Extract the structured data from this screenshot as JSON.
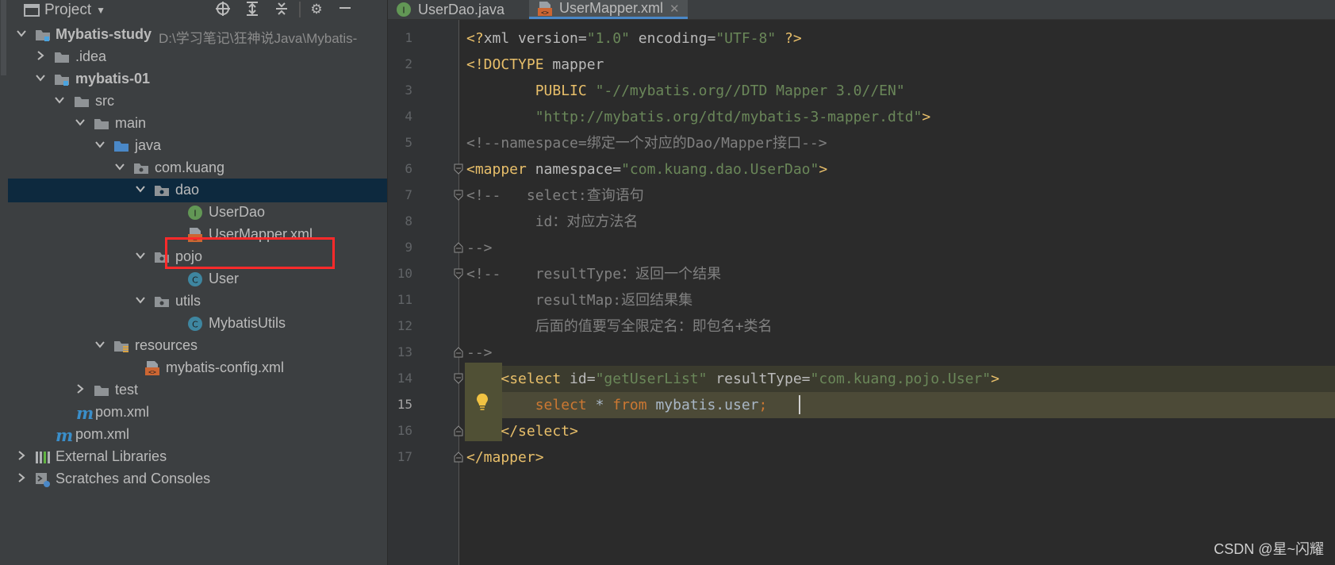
{
  "project_panel": {
    "title": "Project",
    "tree": [
      {
        "label": "Mybatis-study",
        "path": "D:\\学习笔记\\狂神说Java\\Mybatis-"
      },
      {
        "label": ".idea"
      },
      {
        "label": "mybatis-01"
      },
      {
        "label": "src"
      },
      {
        "label": "main"
      },
      {
        "label": "java"
      },
      {
        "label": "com.kuang"
      },
      {
        "label": "dao"
      },
      {
        "label": "UserDao"
      },
      {
        "label": "UserMapper.xml"
      },
      {
        "label": "pojo"
      },
      {
        "label": "User"
      },
      {
        "label": "utils"
      },
      {
        "label": "MybatisUtils"
      },
      {
        "label": "resources"
      },
      {
        "label": "mybatis-config.xml"
      },
      {
        "label": "test"
      },
      {
        "label": "pom.xml"
      },
      {
        "label": "pom.xml"
      },
      {
        "label": "External Libraries"
      },
      {
        "label": "Scratches and Consoles"
      }
    ]
  },
  "editor": {
    "tabs": [
      {
        "label": "UserDao.java"
      },
      {
        "label": "UserMapper.xml",
        "active": true
      }
    ],
    "line_numbers": [
      "1",
      "2",
      "3",
      "4",
      "5",
      "6",
      "7",
      "8",
      "9",
      "10",
      "11",
      "12",
      "13",
      "14",
      "15",
      "16",
      "17"
    ],
    "current_line": 15,
    "code": {
      "l1": {
        "a": "<?",
        "b": "xml",
        "c": " version=",
        "d": "\"1.0\"",
        "e": " encoding=",
        "f": "\"UTF-8\"",
        "g": " ?>"
      },
      "l2": {
        "a": "<!DOCTYPE ",
        "b": "mapper"
      },
      "l3": {
        "a": "        PUBLIC ",
        "b": "\"-//mybatis.org//DTD Mapper 3.0//EN\""
      },
      "l4": {
        "a": "        ",
        "b": "\"http://mybatis.org/dtd/mybatis-3-mapper.dtd\"",
        "c": ">"
      },
      "l5": {
        "a": "<!--namespace=绑定一个对应的Dao/Mapper接口-->"
      },
      "l6": {
        "a": "<mapper",
        "b": " namespace=",
        "c": "\"com.kuang.dao.UserDao\"",
        "d": ">"
      },
      "l7": {
        "a": "<!--   select:查询语句"
      },
      "l8": {
        "a": "        id：对应方法名"
      },
      "l9": {
        "a": "-->"
      },
      "l10": {
        "a": "<!--    resultType：返回一个结果"
      },
      "l11": {
        "a": "        resultMap:返回结果集"
      },
      "l12": {
        "a": "        后面的值要写全限定名：即包名+类名"
      },
      "l13": {
        "a": "-->"
      },
      "l14": {
        "a": "    ",
        "b": "<select",
        "c": " id=",
        "d": "\"getUserList\"",
        "e": " resultType=",
        "f": "\"com.kuang.pojo.User\"",
        "g": ">"
      },
      "l15": {
        "a": "        ",
        "b": "select",
        "c": " * ",
        "d": "from",
        "e": " mybatis.user",
        "f": ";"
      },
      "l16": {
        "a": "    ",
        "b": "</select>"
      },
      "l17": {
        "a": "</mapper>"
      }
    }
  },
  "watermark": "CSDN @星~闪耀",
  "colors": {
    "background": "#2b2b2b",
    "panel": "#3c3f41",
    "selection": "#0d293e",
    "highlight_box": "#ff2a2a",
    "xml_tag": "#e8bf6a",
    "xml_string": "#6a8759",
    "comment": "#808080",
    "keyword": "#cc7832"
  }
}
